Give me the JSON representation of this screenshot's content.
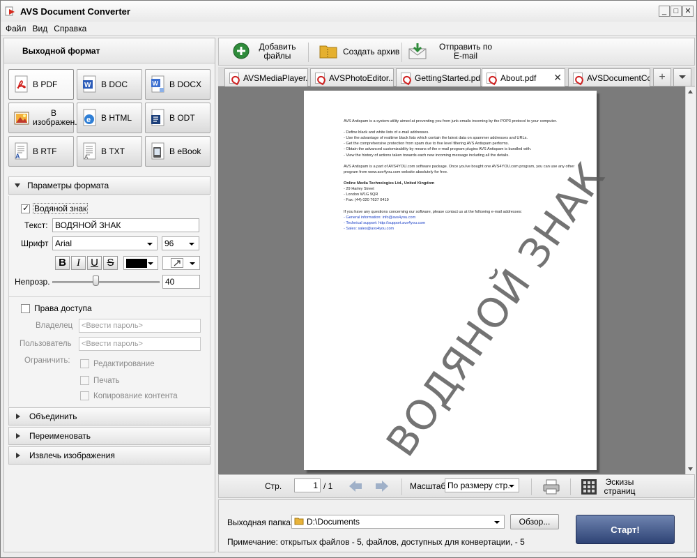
{
  "window": {
    "title": "AVS Document Converter",
    "controls": [
      "_",
      "□",
      "✕"
    ]
  },
  "menu": [
    "Файл",
    "Вид",
    "Справка"
  ],
  "left": {
    "header": "Выходной формат",
    "formats": [
      {
        "label": "В PDF",
        "icon": "pdf-icon"
      },
      {
        "label": "В DOC",
        "icon": "doc-icon"
      },
      {
        "label": "В DOCX",
        "icon": "docx-icon"
      },
      {
        "label": "В изображен.",
        "icon": "image-icon"
      },
      {
        "label": "В HTML",
        "icon": "html-icon"
      },
      {
        "label": "В ODT",
        "icon": "odt-icon"
      },
      {
        "label": "В RTF",
        "icon": "rtf-icon"
      },
      {
        "label": "В TXT",
        "icon": "txt-icon"
      },
      {
        "label": "В eBook",
        "icon": "ebook-icon"
      }
    ],
    "format_params": {
      "header": "Параметры формата",
      "watermark_label": "Водяной знак",
      "watermark_checked": true,
      "text_label": "Текст:",
      "text_value": "ВОДЯНОЙ ЗНАК",
      "font_label": "Шрифт",
      "font_value": "Arial",
      "size_value": "96",
      "bold": "B",
      "italic": "I",
      "underline": "U",
      "strike": "S",
      "color": "#000000",
      "opacity_label": "Непрозр.",
      "opacity_value": "40",
      "opacity_fraction": 0.4
    },
    "access": {
      "label": "Права доступа",
      "checked": false,
      "owner_label": "Владелец",
      "owner_placeholder": "<Ввести пароль>",
      "user_label": "Пользователь",
      "user_placeholder": "<Ввести пароль>",
      "restrict_label": "Ограничить:",
      "restrict_options": [
        "Редактирование",
        "Печать",
        "Копирование контента"
      ]
    },
    "sections": [
      "Объединить",
      "Переименовать",
      "Извлечь изображения"
    ]
  },
  "toolbar": {
    "add_files": "Добавить файлы",
    "create_archive": "Создать архив",
    "send_email": "Отправить по E-mail"
  },
  "tabs": [
    {
      "label": "AVSMediaPlayer...",
      "active": false
    },
    {
      "label": "AVSPhotoEditor....",
      "active": false
    },
    {
      "label": "GettingStarted.pdf",
      "active": false
    },
    {
      "label": "About.pdf",
      "active": true
    },
    {
      "label": "AVSDocumentCo...",
      "active": false
    }
  ],
  "tab_add": "+",
  "document": {
    "intro": "AVS Antispam is a system utility  aimed at preventing you from junk emails incoming by the POP3 protocol to your computer.",
    "bullets": [
      "- Define black and white lists of e-mail addresses.",
      "- Use the advantage of realtime black lists which contain the latest data on spammer addresses and URLs.",
      "- Get the comprehensive protection from spam due to five level filtering AVS Antispam performs.",
      "- Obtain the advanced customizability by means of the e-mail program plugins AVS Antispam is bundled with.",
      "- View the history of actions taken towards each new incoming message including all the details."
    ],
    "package": "AVS Antispam is a part of AVS4YOU.com software package. Once you've bought one AVS4YOU.com program, you can use any other program from www.avs4you.com website absolutely for free.",
    "company": "Online Media Technologies Ltd., United Kingdom",
    "address": [
      "- 29 Harley Street",
      "- London W1G 9QR",
      "- Fax: (44) 020 7637 0419"
    ],
    "contact_intro": "If you have any questions concerning our software, please contact us at the following e-mail addresses:",
    "contacts": [
      "- General information: info@avs4you.com",
      "- Technical support: http://support.avs4you.com",
      "- Sales: sales@avs4you.com"
    ],
    "watermark": "ВОДЯНОЙ ЗНАК"
  },
  "nav": {
    "page_label": "Стр.",
    "page_value": "1",
    "page_total": "/ 1",
    "zoom_label": "Масштаб",
    "zoom_value": "По размеру стр.",
    "thumbnails": "Эскизы страниц"
  },
  "bottom": {
    "output_label": "Выходная папка:",
    "output_value": "D:\\Documents",
    "browse": "Обзор...",
    "start": "Старт!",
    "note": "Примечание: открытых файлов - 5, файлов, доступных для конвертации, - 5"
  }
}
